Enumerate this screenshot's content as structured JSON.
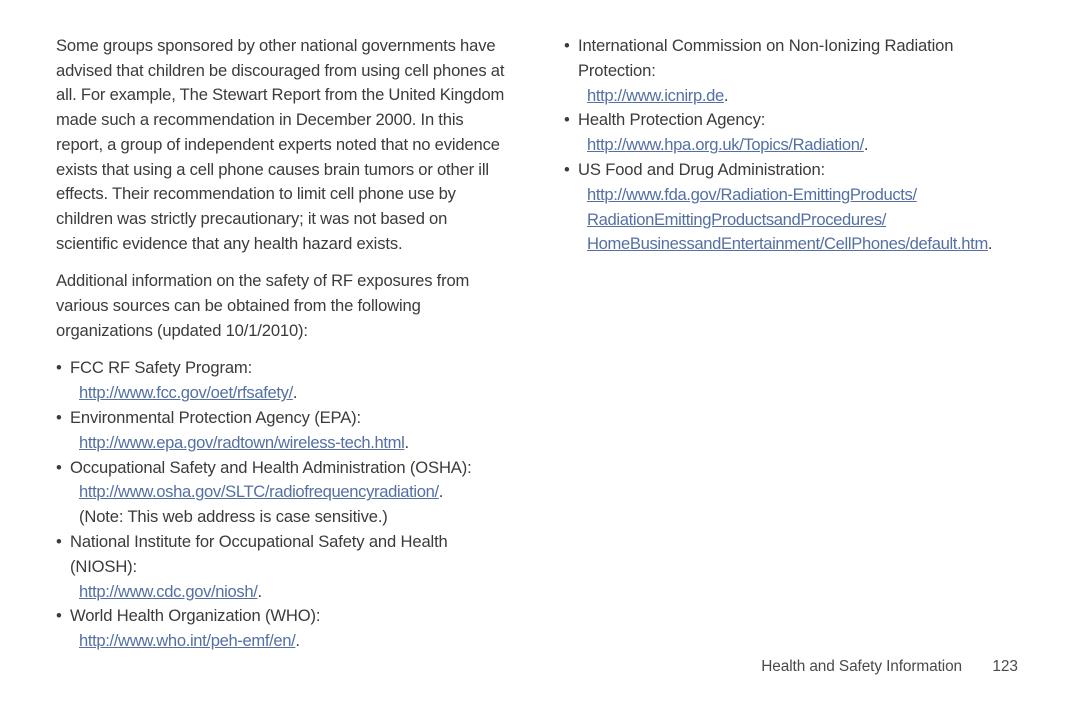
{
  "document": {
    "title": "Health and Safety Information",
    "page_number": "123",
    "link_color": "#5470a3",
    "text_color": "#3b3b3b",
    "background_color": "#ffffff"
  },
  "left_column": {
    "paragraphs": [
      "Some groups sponsored by other national governments have advised that children be discouraged from using cell phones at all. For example, The Stewart Report from the United Kingdom made such a recommendation in December 2000. In this report, a group of independent experts noted that no evidence exists that using a cell phone causes brain tumors or other ill effects. Their recommendation to limit cell phone use by children was strictly precautionary; it was not based on scientific evidence that any health hazard exists.",
      "Additional information on the safety of RF exposures from various sources can be obtained from the following organizations (updated 10/1/2010):"
    ],
    "bullets": [
      {
        "marker": "•",
        "title": "FCC RF Safety Program:",
        "urls": [
          "http://www.fcc.gov/oet/rfsafety/"
        ],
        "note": ""
      },
      {
        "marker": "•",
        "title": "Environmental Protection Agency (EPA):",
        "urls": [
          "http://www.epa.gov/radtown/wireless-tech.html"
        ],
        "note": ""
      },
      {
        "marker": "•",
        "title": "Occupational Safety and Health Administration (OSHA):",
        "urls": [
          "http://www.osha.gov/SLTC/radiofrequencyradiation/"
        ],
        "note": "(Note: This web address is case sensitive.)"
      },
      {
        "marker": "•",
        "title": "National Institute for Occupational Safety and Health (NIOSH):",
        "urls": [
          "http://www.cdc.gov/niosh/"
        ],
        "note": ""
      },
      {
        "marker": "•",
        "title": "World Health Organization (WHO):",
        "urls": [
          "http://www.who.int/peh-emf/en/"
        ],
        "note": ""
      }
    ]
  },
  "right_column": {
    "bullets": [
      {
        "marker": "•",
        "title": "International Commission on Non-Ionizing Radiation Protection:",
        "urls": [
          "http://www.icnirp.de"
        ],
        "note": ""
      },
      {
        "marker": "•",
        "title": "Health Protection Agency:",
        "urls": [
          "http://www.hpa.org.uk/Topics/Radiation/"
        ],
        "note": ""
      },
      {
        "marker": "•",
        "title": "US Food and Drug Administration:",
        "urls": [
          "http://www.fda.gov/Radiation-EmittingProducts/",
          "RadiationEmittingProductsandProcedures/",
          "HomeBusinessandEntertainment/CellPhones/default.htm"
        ],
        "note": ""
      }
    ]
  }
}
